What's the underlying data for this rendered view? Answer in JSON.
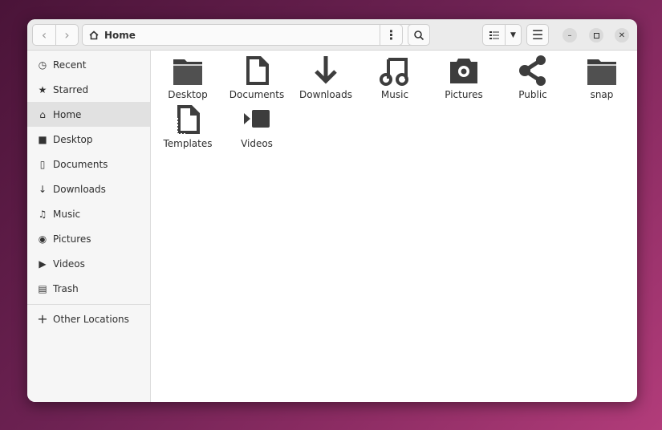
{
  "header": {
    "path_label": "Home"
  },
  "sidebar": {
    "items": [
      {
        "label": "Recent",
        "icon": "clock-icon"
      },
      {
        "label": "Starred",
        "icon": "star-icon"
      },
      {
        "label": "Home",
        "icon": "home-icon",
        "selected": true
      },
      {
        "label": "Desktop",
        "icon": "folder-icon"
      },
      {
        "label": "Documents",
        "icon": "document-icon"
      },
      {
        "label": "Downloads",
        "icon": "download-icon"
      },
      {
        "label": "Music",
        "icon": "music-icon"
      },
      {
        "label": "Pictures",
        "icon": "camera-icon"
      },
      {
        "label": "Videos",
        "icon": "video-icon"
      },
      {
        "label": "Trash",
        "icon": "trash-icon"
      }
    ],
    "other_locations": "Other Locations"
  },
  "files": [
    {
      "label": "Desktop",
      "icon": "folder-icon"
    },
    {
      "label": "Documents",
      "icon": "document-icon"
    },
    {
      "label": "Downloads",
      "icon": "download-icon"
    },
    {
      "label": "Music",
      "icon": "music-icon"
    },
    {
      "label": "Pictures",
      "icon": "camera-icon"
    },
    {
      "label": "Public",
      "icon": "share-icon"
    },
    {
      "label": "snap",
      "icon": "folder-icon"
    },
    {
      "label": "Templates",
      "icon": "template-icon"
    },
    {
      "label": "Videos",
      "icon": "video-icon"
    }
  ]
}
